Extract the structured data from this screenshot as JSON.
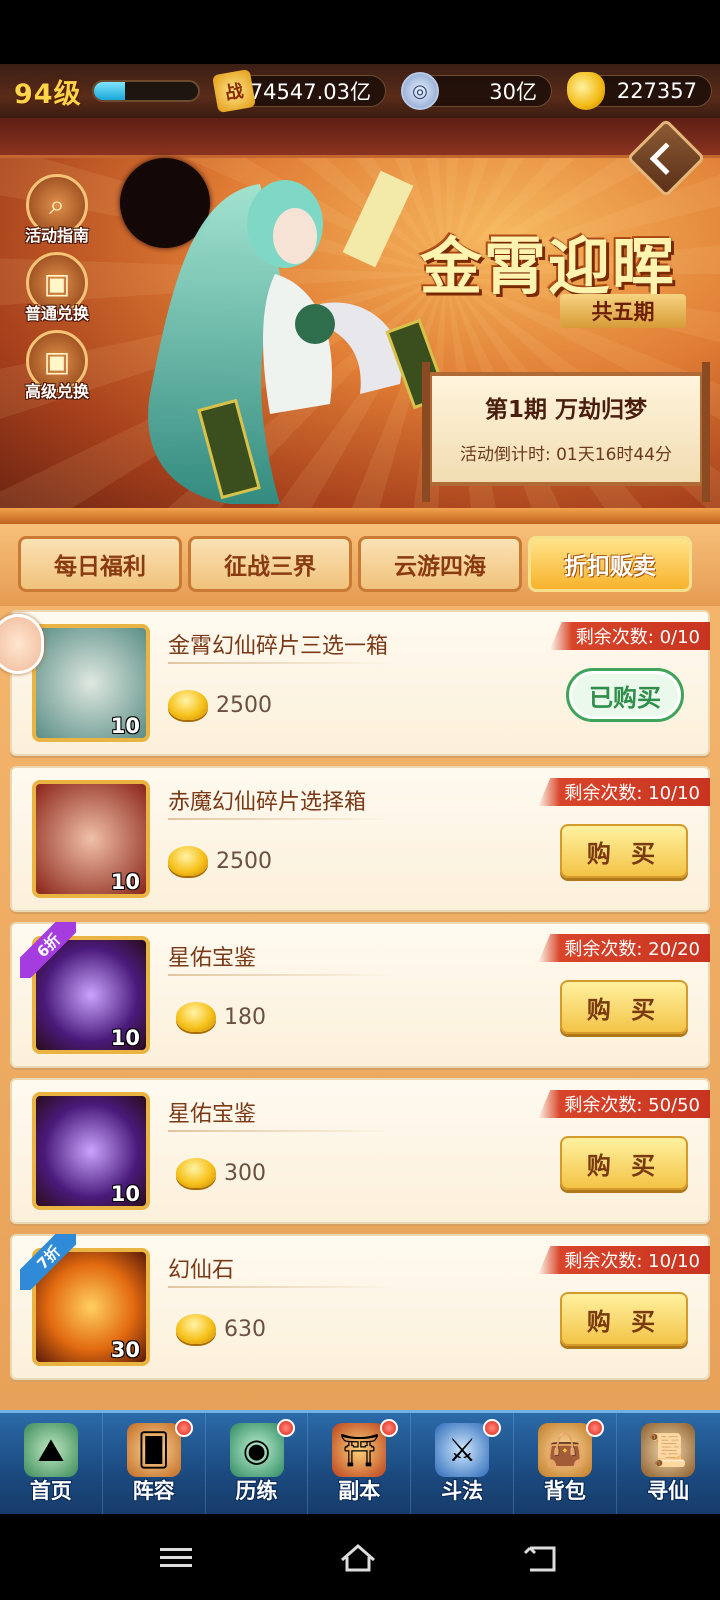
{
  "hud": {
    "level": "94级",
    "exp_fraction": 0.3,
    "power_icon_char": "战",
    "power": "74547.03亿",
    "coins": "30亿",
    "gold": "227357"
  },
  "banner": {
    "title": "金霄迎晖",
    "subtitle": "共五期",
    "period_title": "第1期  万劫归梦",
    "countdown": "活动倒计时: 01天16时44分",
    "side_buttons": [
      {
        "label": "活动指南",
        "icon": "magnifier-icon"
      },
      {
        "label": "普通兑换",
        "icon": "gift-box-icon"
      },
      {
        "label": "高级兑换",
        "icon": "gift-box-icon"
      }
    ]
  },
  "tabs": [
    {
      "label": "每日福利",
      "active": false
    },
    {
      "label": "征战三界",
      "active": false
    },
    {
      "label": "云游四海",
      "active": false
    },
    {
      "label": "折扣贩卖",
      "active": true
    }
  ],
  "items": [
    {
      "name": "金霄幻仙碎片三选一箱",
      "qty": "10",
      "price": "2500",
      "limit": "剩余次数: 0/10",
      "button": "已购买",
      "bought": true,
      "discount": ""
    },
    {
      "name": "赤魔幻仙碎片选择箱",
      "qty": "10",
      "price": "2500",
      "limit": "剩余次数: 10/10",
      "button": "购 买",
      "bought": false,
      "discount": ""
    },
    {
      "name": "星佑宝鉴",
      "qty": "10",
      "price": "180",
      "limit": "剩余次数: 20/20",
      "button": "购 买",
      "bought": false,
      "discount": "6折"
    },
    {
      "name": "星佑宝鉴",
      "qty": "10",
      "price": "300",
      "limit": "剩余次数: 50/50",
      "button": "购 买",
      "bought": false,
      "discount": ""
    },
    {
      "name": "幻仙石",
      "qty": "30",
      "price": "630",
      "limit": "剩余次数: 10/10",
      "button": "购 买",
      "bought": false,
      "discount": "7折"
    }
  ],
  "nav": [
    {
      "label": "首页",
      "icon": "home-icon",
      "dot": false
    },
    {
      "label": "阵容",
      "icon": "lineup-icon",
      "dot": true
    },
    {
      "label": "历练",
      "icon": "training-icon",
      "dot": true
    },
    {
      "label": "副本",
      "icon": "dungeon-icon",
      "dot": true
    },
    {
      "label": "斗法",
      "icon": "battle-icon",
      "dot": true
    },
    {
      "label": "背包",
      "icon": "bag-icon",
      "dot": true
    },
    {
      "label": "寻仙",
      "icon": "seek-icon",
      "dot": false
    }
  ],
  "colors": {
    "discount_purple": "#a43ce0",
    "discount_blue": "#2f8ad8",
    "limit_red": "#c83420",
    "bought_green": "#3ea35b"
  }
}
